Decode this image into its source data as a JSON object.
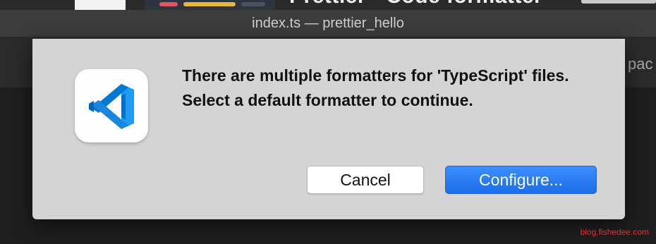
{
  "background": {
    "heading": "Prettier - Code formatter",
    "right_text": "pac"
  },
  "window": {
    "title": "index.ts — prettier_hello"
  },
  "dialog": {
    "icon": "vscode-icon",
    "message": "There are multiple formatters for 'TypeScript' files. Select a default formatter to continue.",
    "cancel_label": "Cancel",
    "configure_label": "Configure...",
    "accent_color": "#1b6de6",
    "icon_color": "#0078d4"
  },
  "watermark": "blog.fishedee.com"
}
